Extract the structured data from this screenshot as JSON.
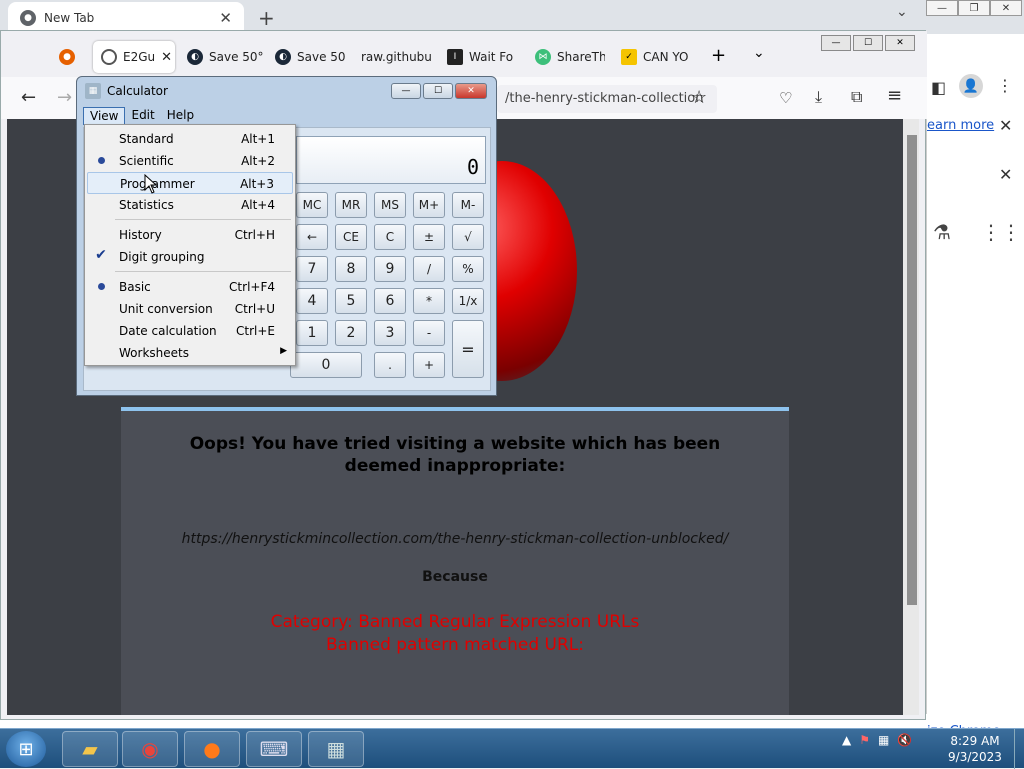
{
  "chrome": {
    "tab_title": "New Tab",
    "learn_more": "earn more",
    "customize": "ize Chrome"
  },
  "firefox": {
    "tabs": [
      {
        "label": "E2Gu"
      },
      {
        "label": "Save 50°"
      },
      {
        "label": "Save 50°"
      },
      {
        "label": "raw.githubu"
      },
      {
        "label": "Wait Fo"
      },
      {
        "label": "ShareTh"
      },
      {
        "label": "CAN YO"
      }
    ],
    "url": "/the-henry-stickman-collection",
    "block": {
      "title": "Oops! You have tried visiting a website which has been deemed inappropriate:",
      "url": "https://henrystickmincollection.com/the-henry-stickman-collection-unblocked/",
      "because": "Because",
      "category": "Category: Banned Regular Expression URLs",
      "pattern": "Banned pattern matched URL:"
    }
  },
  "calculator": {
    "title": "Calculator",
    "menu": [
      "View",
      "Edit",
      "Help"
    ],
    "display": "0",
    "buttons": {
      "mc": "MC",
      "mr": "MR",
      "ms": "MS",
      "mplus": "M+",
      "mminus": "M-",
      "back": "←",
      "ce": "CE",
      "c": "C",
      "pm": "±",
      "sqrt": "√",
      "n7": "7",
      "n8": "8",
      "n9": "9",
      "div": "/",
      "pct": "%",
      "n4": "4",
      "n5": "5",
      "n6": "6",
      "mul": "*",
      "inv": "1/x",
      "n1": "1",
      "n2": "2",
      "n3": "3",
      "sub": "-",
      "eq": "=",
      "n0": "0",
      "dot": ".",
      "add": "+"
    },
    "view_menu": [
      {
        "label": "Standard",
        "acc": "Alt+1",
        "mark": ""
      },
      {
        "label": "Scientific",
        "acc": "Alt+2",
        "mark": "dot"
      },
      {
        "label": "Programmer",
        "acc": "Alt+3",
        "mark": ""
      },
      {
        "label": "Statistics",
        "acc": "Alt+4",
        "mark": ""
      },
      {
        "label": "History",
        "acc": "Ctrl+H",
        "mark": ""
      },
      {
        "label": "Digit grouping",
        "acc": "",
        "mark": "check"
      },
      {
        "label": "Basic",
        "acc": "Ctrl+F4",
        "mark": "dot"
      },
      {
        "label": "Unit conversion",
        "acc": "Ctrl+U",
        "mark": ""
      },
      {
        "label": "Date calculation",
        "acc": "Ctrl+E",
        "mark": ""
      },
      {
        "label": "Worksheets",
        "acc": "",
        "mark": "submenu"
      }
    ]
  },
  "taskbar": {
    "time": "8:29 AM",
    "date": "9/3/2023"
  }
}
